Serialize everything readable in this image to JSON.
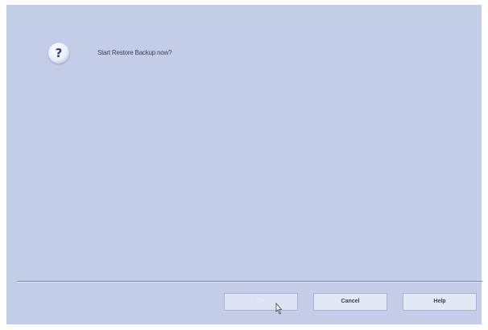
{
  "dialog": {
    "message": "Start Restore Backup now?",
    "icon": "question-icon"
  },
  "buttons": {
    "ok_label": "OK",
    "cancel_label": "Cancel",
    "help_label": "Help"
  },
  "colors": {
    "background": "#c3cde8",
    "separator": "#7d88b3",
    "button_face": "#e3e8f5"
  }
}
